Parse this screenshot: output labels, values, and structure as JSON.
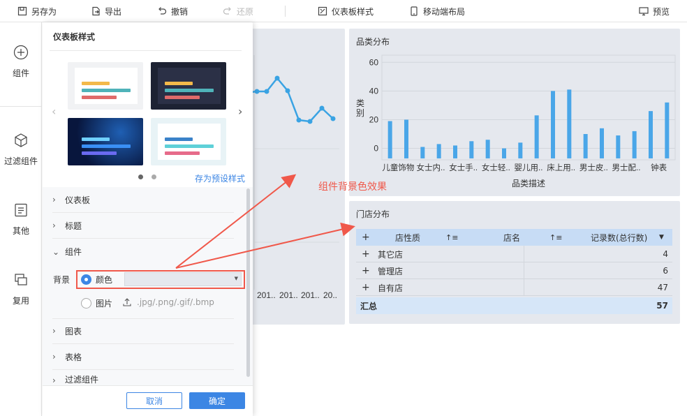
{
  "toolbar": {
    "save_as": "另存为",
    "export": "导出",
    "undo": "撤销",
    "redo": "还原",
    "dashboard_style": "仪表板样式",
    "mobile_layout": "移动端布局",
    "preview": "预览"
  },
  "rail": {
    "component": "组件",
    "filter_component": "过滤组件",
    "other": "其他",
    "reuse": "复用"
  },
  "dialog": {
    "title": "仪表板样式",
    "save_preset": "存为预设样式",
    "sections": {
      "dashboard": "仪表板",
      "title": "标题",
      "component": "组件",
      "chart": "图表",
      "table": "表格",
      "filter_component": "过滤组件"
    },
    "background_label": "背景",
    "color_option": "颜色",
    "image_option": "图片",
    "image_formats": ".jpg/.png/.gif/.bmp",
    "cancel": "取消",
    "confirm": "确定"
  },
  "annotation": {
    "text": "组件背景色效果",
    "color": "#f0584a"
  },
  "line_chart": {
    "x_ticks": [
      "201..",
      "201..",
      "201..",
      "20.."
    ]
  },
  "bar_card": {
    "title": "品类分布",
    "y_axis_title": "类别",
    "x_axis_title": "品类描述"
  },
  "chart_data": {
    "type": "bar",
    "title": "品类分布",
    "xlabel": "品类描述",
    "ylabel": "类别",
    "ylim": [
      -8,
      65
    ],
    "yticks": [
      0,
      20,
      40,
      60
    ],
    "category_labels": [
      "儿童饰物",
      "女士内..",
      "女士手..",
      "女士轻..",
      "婴儿用..",
      "床上用..",
      "男士皮..",
      "男士配..",
      "钟表"
    ],
    "values": [
      19,
      20,
      1,
      3,
      2,
      5,
      6,
      0,
      4,
      23,
      40,
      41,
      10,
      14,
      9,
      12,
      26,
      32
    ],
    "bar_color": "#4aa6e8",
    "grid": true
  },
  "store_card": {
    "title": "门店分布",
    "headers": [
      "店性质",
      "店名",
      "记录数(总行数)"
    ],
    "rows": [
      {
        "name": "其它店",
        "count": "4"
      },
      {
        "name": "管理店",
        "count": "6"
      },
      {
        "name": "自有店",
        "count": "47"
      }
    ],
    "total_label": "汇总",
    "total_value": "57"
  },
  "colors": {
    "accent": "#3c86e4",
    "bar": "#4aa6e8",
    "card_bg": "#e5e8ee",
    "highlight_border": "#f0584a"
  }
}
